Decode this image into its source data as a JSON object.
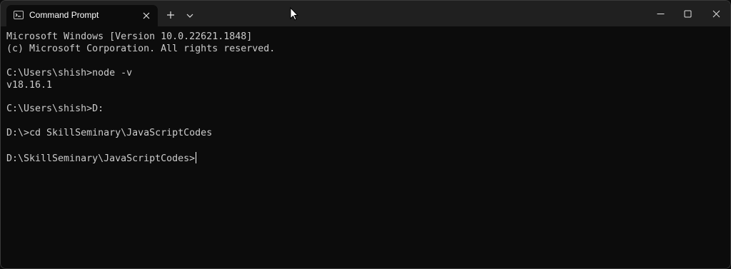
{
  "tab": {
    "title": "Command Prompt",
    "icon": "command-prompt-icon",
    "close_icon": "close-icon"
  },
  "titlebar": {
    "new_tab_icon": "plus-icon",
    "dropdown_icon": "chevron-down-icon",
    "minimize_icon": "minimize-icon",
    "maximize_icon": "maximize-icon",
    "close_icon": "close-icon"
  },
  "terminal": {
    "lines": [
      "Microsoft Windows [Version 10.0.22621.1848]",
      "(c) Microsoft Corporation. All rights reserved.",
      "",
      "C:\\Users\\shish>node -v",
      "v18.16.1",
      "",
      "C:\\Users\\shish>D:",
      "",
      "D:\\>cd SkillSeminary\\JavaScriptCodes",
      "",
      "D:\\SkillSeminary\\JavaScriptCodes>"
    ],
    "text_color": "#cccccc",
    "background": "#0c0c0c"
  },
  "colors": {
    "titlebar": "#202020",
    "tab_active": "#0c0c0c"
  }
}
